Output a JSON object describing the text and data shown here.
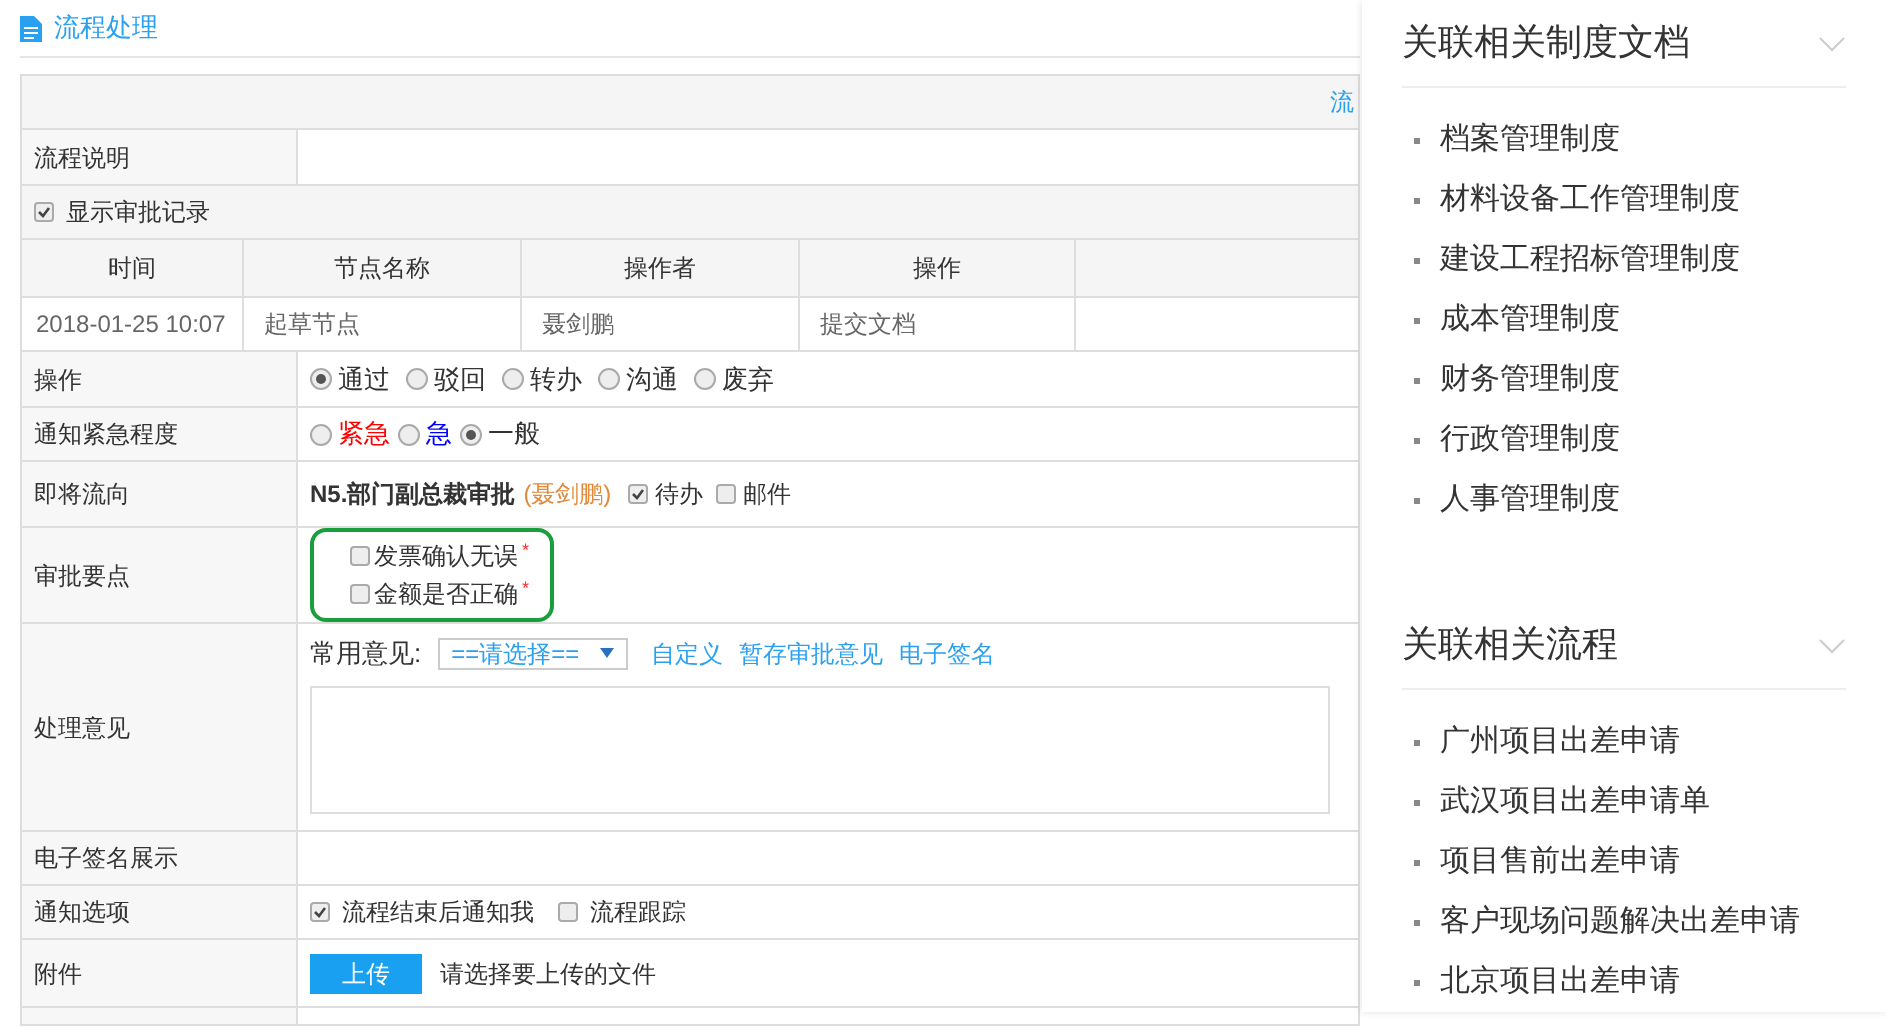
{
  "header": {
    "title": "流程处理"
  },
  "form": {
    "top_link": "流",
    "process_description": {
      "label": "流程说明"
    },
    "show_records": {
      "label": "显示审批记录",
      "checked": true
    },
    "records": {
      "columns": [
        "时间",
        "节点名称",
        "操作者",
        "操作"
      ],
      "rows": [
        {
          "time": "2018-01-25 10:07",
          "node": "起草节点",
          "operator": "聂剑鹏",
          "action": "提交文档"
        }
      ]
    },
    "operation": {
      "label": "操作",
      "options": [
        {
          "label": "通过",
          "selected": true
        },
        {
          "label": "驳回",
          "selected": false
        },
        {
          "label": "转办",
          "selected": false
        },
        {
          "label": "沟通",
          "selected": false
        },
        {
          "label": "废弃",
          "selected": false
        }
      ]
    },
    "urgency": {
      "label": "通知紧急程度",
      "options": [
        {
          "label": "紧急",
          "color": "#ff0000",
          "selected": false
        },
        {
          "label": "急",
          "color": "#0000ff",
          "selected": false
        },
        {
          "label": "一般",
          "color": "#333333",
          "selected": true
        }
      ]
    },
    "next_step": {
      "label": "即将流向",
      "node": "N5.部门副总裁审批",
      "assignee": "(聂剑鹏)",
      "options": [
        {
          "label": "待办",
          "checked": true
        },
        {
          "label": "邮件",
          "checked": false
        }
      ]
    },
    "key_points": {
      "label": "审批要点",
      "items": [
        {
          "label": "发票确认无误",
          "mark": "*",
          "checked": false
        },
        {
          "label": "金额是否正确",
          "mark": "*",
          "checked": false
        }
      ]
    },
    "opinion": {
      "label": "处理意见",
      "common_label": "常用意见:",
      "select": {
        "value": "==请选择=="
      },
      "links": [
        "自定义",
        "暂存审批意见",
        "电子签名"
      ]
    },
    "signature": {
      "label": "电子签名展示"
    },
    "notify": {
      "label": "通知选项",
      "options": [
        {
          "label": "流程结束后通知我",
          "checked": true
        },
        {
          "label": "流程跟踪",
          "checked": false
        }
      ]
    },
    "attachment": {
      "label": "附件",
      "button": "上传",
      "hint": "请选择要上传的文件"
    }
  },
  "side_panels": [
    {
      "title": "关联相关制度文档",
      "items": [
        "档案管理制度",
        "材料设备工作管理制度",
        "建设工程招标管理制度",
        "成本管理制度",
        "财务管理制度",
        "行政管理制度",
        "人事管理制度"
      ]
    },
    {
      "title": "关联相关流程",
      "items": [
        "广州项目出差申请",
        "武汉项目出差申请单",
        "项目售前出差申请",
        "客户现场问题解决出差申请",
        "北京项目出差申请"
      ]
    }
  ]
}
